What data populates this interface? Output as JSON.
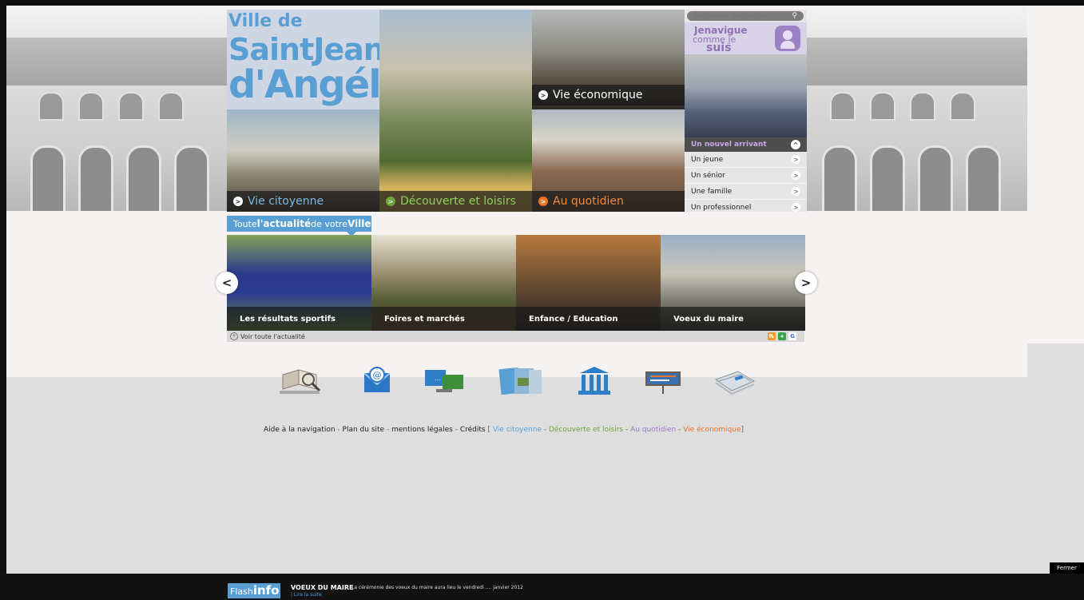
{
  "search": {
    "placeholder": "Rechercher dans le site",
    "icon": "search-icon"
  },
  "logo": {
    "line1": "Ville de",
    "line2": "SaintJean",
    "line3": "d'Angély"
  },
  "tiles": {
    "vie_citoyenne": "Vie citoyenne",
    "decouverte": "Découverte et loisirs",
    "vie_economique": "Vie économique",
    "au_quotidien": "Au quotidien"
  },
  "navigue": {
    "line1": "Jenavigue",
    "line2": "comme je",
    "line3": "suis"
  },
  "profiles": {
    "header": "Un nouvel arrivant",
    "items": [
      "Un jeune",
      "Un sénior",
      "Une famille",
      "Un professionnel"
    ]
  },
  "news": {
    "tab_prefix": "Toute ",
    "tab_bold": "l'actualité",
    "tab_mid": " de votre ",
    "tab_suffix": "Ville",
    "items": [
      "Les résultats sportifs",
      "Foires et marchés",
      "Enfance / Education",
      "Voeux du maire"
    ],
    "see_all": "Voir toute l'actualité",
    "prev": "<",
    "next": ">"
  },
  "icon_names": [
    "book-icon",
    "email-icon",
    "monitor-icon",
    "magazine-icon",
    "institution-icon",
    "board-icon",
    "newspaper-icon"
  ],
  "footer": {
    "links": [
      "Aide à la navigation",
      "Plan du site",
      "mentions légales",
      "Crédits"
    ],
    "sections": [
      "Vie citoyenne",
      "Découverte et loisirs",
      "Au quotidien",
      "Vie économique"
    ],
    "sep": " - ",
    "bracket_open": " [ ",
    "bracket_close": "]"
  },
  "fermer": "Fermer",
  "flash": {
    "label1": "Flash",
    "label2": "info",
    "title": "VOEUX DU MAIRE",
    "text": "La cérémonie des voeux du maire aura lieu le vendredi .... janvier 2012",
    "read_more": "| Lire la suite"
  },
  "colors": {
    "accent": "#5a9fd4",
    "citoyenne": "#5a9fd4",
    "decouverte": "#6aa53a",
    "quotidien": "#9c7cc8",
    "economique": "#e8742a"
  }
}
